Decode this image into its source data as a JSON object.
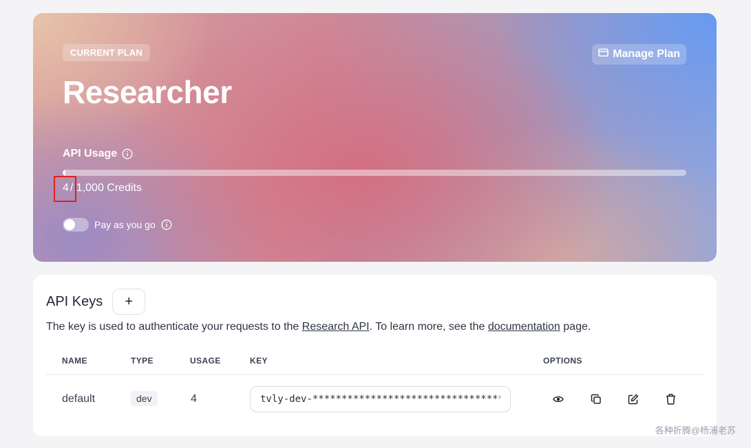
{
  "plan": {
    "badge": "CURRENT PLAN",
    "name": "Researcher",
    "manage_label": "Manage Plan",
    "usage_label": "API Usage",
    "usage_used": "4",
    "usage_rest": "/ 1,000 Credits",
    "usage_fraction": 0.004,
    "payg_label": "Pay as you go",
    "payg_enabled": false
  },
  "keys": {
    "title": "API Keys",
    "add_label": "+",
    "desc_prefix": "The key is used to authenticate your requests to the ",
    "desc_link1": "Research API",
    "desc_middle": ". To learn more, see the ",
    "desc_link2": "documentation",
    "desc_suffix": " page.",
    "columns": [
      "NAME",
      "TYPE",
      "USAGE",
      "KEY",
      "OPTIONS"
    ],
    "rows": [
      {
        "name": "default",
        "type": "dev",
        "usage": "4",
        "key": "tvly-dev-****************************************",
        "options": [
          "eye-icon",
          "copy-icon",
          "edit-icon",
          "trash-icon"
        ]
      }
    ]
  },
  "watermark": "各种折腾@杨浦老苏",
  "colors": {
    "highlight": "#e0201c",
    "plan_gradient": [
      "#e8c6aa",
      "#d46e80",
      "#968ac8",
      "#689af0"
    ]
  }
}
